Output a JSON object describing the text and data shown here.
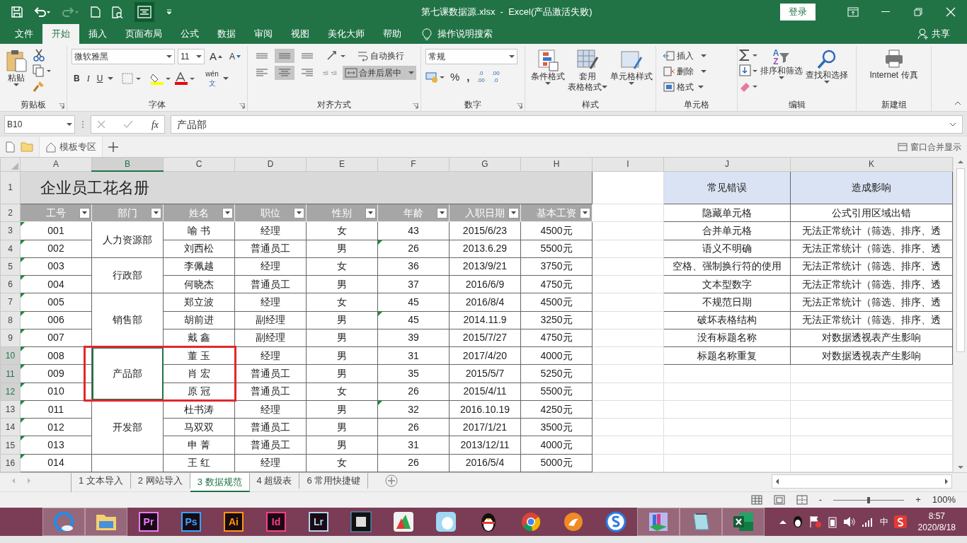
{
  "window": {
    "title": "第七课数据源.xlsx  -  Excel(产品激活失败)",
    "login": "登录"
  },
  "ribbon_tabs": [
    {
      "label": "文件",
      "selected": false
    },
    {
      "label": "开始",
      "selected": true
    },
    {
      "label": "插入",
      "selected": false
    },
    {
      "label": "页面布局",
      "selected": false
    },
    {
      "label": "公式",
      "selected": false
    },
    {
      "label": "数据",
      "selected": false
    },
    {
      "label": "审阅",
      "selected": false
    },
    {
      "label": "视图",
      "selected": false
    },
    {
      "label": "美化大师",
      "selected": false
    },
    {
      "label": "帮助",
      "selected": false
    }
  ],
  "tell_me": "操作说明搜索",
  "share": "共享",
  "ribbon": {
    "clipboard": {
      "paste": "粘贴",
      "label": "剪贴板"
    },
    "font": {
      "family": "微软雅黑",
      "size": "11",
      "grow": "A",
      "shrink": "A",
      "bold": "B",
      "italic": "I",
      "underline": "U",
      "phonetic_top": "wén",
      "phonetic_bottom": "文",
      "label": "字体"
    },
    "alignment": {
      "wrap": "自动换行",
      "merge": "合并后居中",
      "merge_active": true,
      "vertical_buttons": [
        {
          "kind": "top",
          "selected": false
        },
        {
          "kind": "middle",
          "selected": true
        },
        {
          "kind": "bottom",
          "selected": false
        }
      ],
      "horizontal_buttons": [
        {
          "kind": "left",
          "selected": false
        },
        {
          "kind": "center",
          "selected": true
        },
        {
          "kind": "right",
          "selected": false
        }
      ],
      "label": "对齐方式"
    },
    "number": {
      "format": "常规",
      "percent": "%",
      "comma": ",",
      "dec_inc_top": ".0",
      "dec_inc_bottom": ".00",
      "dec_dec_top": ".00",
      "dec_dec_bottom": ".0",
      "label": "数字"
    },
    "styles": {
      "conditional": "条件格式",
      "table_top": "套用",
      "table_bottom": "表格格式",
      "cell": "单元格样式",
      "label": "样式"
    },
    "cells": {
      "insert": "插入",
      "delete": "删除",
      "format": "格式",
      "label": "单元格"
    },
    "editing": {
      "sort_top": "A",
      "sort_bottom": "Z",
      "sort": "排序和筛选",
      "find": "查找和选择",
      "label": "编辑"
    },
    "new_group": {
      "fax": "Internet 传真",
      "label": "新建组"
    }
  },
  "formula_bar": {
    "name_box": "B10",
    "fx": "fx",
    "content": "产品部"
  },
  "template_bar": {
    "tab": "模板专区",
    "merge_windows": "窗口合并显示"
  },
  "sheet": {
    "columns": [
      {
        "label": "A",
        "selected": false
      },
      {
        "label": "B",
        "selected": true
      },
      {
        "label": "C",
        "selected": false
      },
      {
        "label": "D",
        "selected": false
      },
      {
        "label": "E",
        "selected": false
      },
      {
        "label": "F",
        "selected": false
      },
      {
        "label": "G",
        "selected": false
      },
      {
        "label": "H",
        "selected": false
      },
      {
        "label": "I",
        "selected": false
      },
      {
        "label": "J",
        "selected": false
      },
      {
        "label": "K",
        "selected": false
      }
    ],
    "row_numbers": [
      {
        "label": "1",
        "selected": false
      },
      {
        "label": "2",
        "selected": false
      },
      {
        "label": "3",
        "selected": false
      },
      {
        "label": "4",
        "selected": false
      },
      {
        "label": "5",
        "selected": false
      },
      {
        "label": "6",
        "selected": false
      },
      {
        "label": "7",
        "selected": false
      },
      {
        "label": "8",
        "selected": false
      },
      {
        "label": "9",
        "selected": false
      },
      {
        "label": "10",
        "selected": true
      },
      {
        "label": "11",
        "selected": true
      },
      {
        "label": "12",
        "selected": true
      },
      {
        "label": "13",
        "selected": false
      },
      {
        "label": "14",
        "selected": false
      },
      {
        "label": "15",
        "selected": false
      },
      {
        "label": "16",
        "selected": false
      }
    ],
    "title": "企业员工花名册",
    "headers": [
      "工号",
      "部门",
      "姓名",
      "职位",
      "性别",
      "年龄",
      "入职日期",
      "基本工资"
    ],
    "departments": [
      {
        "name": "人力资源部",
        "selected": false,
        "framed": false,
        "employees": [
          {
            "id": "001",
            "name": "喻 书",
            "title": "经理",
            "sex": "女",
            "age": "43",
            "hired": "2015/6/23",
            "salary": "4500元",
            "age_warning": false
          },
          {
            "id": "002",
            "name": "刘西松",
            "title": "普通员工",
            "sex": "男",
            "age": "26",
            "hired": "2013.6.29",
            "salary": "5500元",
            "age_warning": true
          }
        ]
      },
      {
        "name": "行政部",
        "selected": false,
        "framed": false,
        "employees": [
          {
            "id": "003",
            "name": "李佩越",
            "title": "经理",
            "sex": "女",
            "age": "36",
            "hired": "2013/9/21",
            "salary": "3750元",
            "age_warning": false
          },
          {
            "id": "004",
            "name": "何晓杰",
            "title": "普通员工",
            "sex": "男",
            "age": "37",
            "hired": "2016/6/9",
            "salary": "4750元",
            "age_warning": false
          }
        ]
      },
      {
        "name": "销售部",
        "selected": false,
        "framed": false,
        "employees": [
          {
            "id": "005",
            "name": "郑立波",
            "title": "经理",
            "sex": "女",
            "age": "45",
            "hired": "2016/8/4",
            "salary": "4500元",
            "age_warning": false
          },
          {
            "id": "006",
            "name": "胡前进",
            "title": "副经理",
            "sex": "男",
            "age": "45",
            "hired": "2014.11.9",
            "salary": "3250元",
            "age_warning": true
          },
          {
            "id": "007",
            "name": "戴 鑫",
            "title": "副经理",
            "sex": "男",
            "age": "39",
            "hired": "2015/7/27",
            "salary": "4750元",
            "age_warning": false
          }
        ]
      },
      {
        "name": "产品部",
        "selected": true,
        "framed": true,
        "employees": [
          {
            "id": "008",
            "name": "董 玉",
            "title": "经理",
            "sex": "男",
            "age": "31",
            "hired": "2017/4/20",
            "salary": "4000元",
            "age_warning": false
          },
          {
            "id": "009",
            "name": "肖 宏",
            "title": "普通员工",
            "sex": "男",
            "age": "35",
            "hired": "2015/5/7",
            "salary": "5250元",
            "age_warning": false
          },
          {
            "id": "010",
            "name": "原 冠",
            "title": "普通员工",
            "sex": "女",
            "age": "26",
            "hired": "2015/4/11",
            "salary": "5500元",
            "age_warning": false
          }
        ]
      },
      {
        "name": "开发部",
        "selected": false,
        "framed": false,
        "employees": [
          {
            "id": "011",
            "name": "杜书涛",
            "title": "经理",
            "sex": "男",
            "age": "32",
            "hired": "2016.10.19",
            "salary": "4250元",
            "age_warning": true
          },
          {
            "id": "012",
            "name": "马双双",
            "title": "普通员工",
            "sex": "男",
            "age": "26",
            "hired": "2017/1/21",
            "salary": "3500元",
            "age_warning": false
          },
          {
            "id": "013",
            "name": "申 菁",
            "title": "普通员工",
            "sex": "男",
            "age": "31",
            "hired": "2013/12/11",
            "salary": "4000元",
            "age_warning": false
          }
        ]
      },
      {
        "selected": false,
        "framed": false,
        "employees": [
          {
            "id": "014",
            "name": "王 红",
            "title": "经理",
            "sex": "女",
            "age": "26",
            "hired": "2016/5/4",
            "salary": "5000元",
            "age_warning": false
          }
        ]
      }
    ],
    "side_table": {
      "columns": [
        "常见错误",
        "造成影响"
      ],
      "rows": [
        [
          "隐藏单元格",
          "公式引用区域出错"
        ],
        [
          "合并单元格",
          "无法正常统计（筛选、排序、透"
        ],
        [
          "语义不明确",
          "无法正常统计（筛选、排序、透"
        ],
        [
          "空格、强制换行符的使用",
          "无法正常统计（筛选、排序、透"
        ],
        [
          "文本型数字",
          "无法正常统计（筛选、排序、透"
        ],
        [
          "不规范日期",
          "无法正常统计（筛选、排序、透"
        ],
        [
          "破坏表格结构",
          "无法正常统计（筛选、排序、透"
        ],
        [
          "没有标题名称",
          "对数据透视表产生影响"
        ],
        [
          "标题名称重复",
          "对数据透视表产生影响"
        ]
      ]
    }
  },
  "sheets": [
    {
      "label": "1 文本导入",
      "selected": false
    },
    {
      "label": "2 网站导入",
      "selected": false
    },
    {
      "label": "3 数据规范",
      "selected": true
    },
    {
      "label": "4 超级表",
      "selected": false
    },
    {
      "label": "6 常用快捷键",
      "selected": false
    }
  ],
  "status_bar": {
    "zoom_minus": "-",
    "zoom_plus": "+",
    "zoom": "100%",
    "zoom_slider": {
      "level": 0.5
    }
  },
  "taskbar": {
    "items": [
      {
        "kind": "browser",
        "active": true
      },
      {
        "kind": "folder",
        "active": true
      },
      {
        "kind": "adobe",
        "label": "Pr",
        "color": "#e77cff",
        "active": false
      },
      {
        "kind": "adobe",
        "label": "Ps",
        "color": "#31a8ff",
        "active": false
      },
      {
        "kind": "adobe",
        "label": "Ai",
        "color": "#ff9a00",
        "active": false
      },
      {
        "kind": "adobe",
        "label": "Id",
        "color": "#ff3d8b",
        "active": false
      },
      {
        "kind": "adobe",
        "label": "Lr",
        "color": "#add5ec",
        "active": false
      },
      {
        "kind": "film",
        "active": false
      },
      {
        "kind": "ruler",
        "active": false
      },
      {
        "kind": "cartoon",
        "active": false
      },
      {
        "kind": "penguin",
        "active": false
      },
      {
        "kind": "chrome",
        "active": false
      },
      {
        "kind": "cheetah",
        "active": false
      },
      {
        "kind": "sbrowser",
        "active": false
      },
      {
        "kind": "books",
        "active": true
      },
      {
        "kind": "notepad",
        "active": true
      },
      {
        "kind": "excel",
        "active": true
      }
    ],
    "tray": {
      "ime": "中",
      "time": "8:57",
      "date": "2020/8/18"
    }
  }
}
